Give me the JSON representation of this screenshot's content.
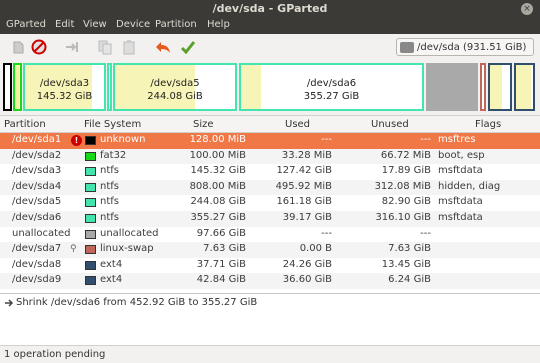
{
  "window": {
    "title": "/dev/sda - GParted",
    "close_glyph": "×"
  },
  "menu": [
    "GParted",
    "Edit",
    "View",
    "Device",
    "Partition",
    "Help"
  ],
  "toolbar": {
    "buttons": [
      {
        "name": "new-partition-icon",
        "enabled": false
      },
      {
        "name": "delete-icon",
        "enabled": true
      },
      {
        "name": "resize-move-icon",
        "enabled": false
      },
      {
        "name": "copy-icon",
        "enabled": false
      },
      {
        "name": "paste-icon",
        "enabled": false
      },
      {
        "name": "undo-icon",
        "enabled": true
      },
      {
        "name": "apply-icon",
        "enabled": true
      }
    ]
  },
  "device_selector": {
    "label": "/dev/sda   (931.51 GiB)"
  },
  "map": {
    "sda3": {
      "name": "/dev/sda3",
      "size": "145.32 GiB"
    },
    "sda5": {
      "name": "/dev/sda5",
      "size": "244.08 GiB"
    },
    "sda6": {
      "name": "/dev/sda6",
      "size": "355.27 GiB"
    }
  },
  "table": {
    "headers": {
      "partition": "Partition",
      "filesystem": "File System",
      "size": "Size",
      "used": "Used",
      "unused": "Unused",
      "flags": "Flags"
    },
    "rows": [
      {
        "partition": "/dev/sda1",
        "fs": "unknown",
        "color": "#000000",
        "size": "128.00 MiB",
        "used": "---",
        "unused": "---",
        "flags": "msftres",
        "icon": "warning"
      },
      {
        "partition": "/dev/sda2",
        "fs": "fat32",
        "color": "#18d918",
        "size": "100.00 MiB",
        "used": "33.28 MiB",
        "unused": "66.72 MiB",
        "flags": "boot, esp",
        "icon": ""
      },
      {
        "partition": "/dev/sda3",
        "fs": "ntfs",
        "color": "#42e5ac",
        "size": "145.32 GiB",
        "used": "127.42 GiB",
        "unused": "17.89 GiB",
        "flags": "msftdata",
        "icon": ""
      },
      {
        "partition": "/dev/sda4",
        "fs": "ntfs",
        "color": "#42e5ac",
        "size": "808.00 MiB",
        "used": "495.92 MiB",
        "unused": "312.08 MiB",
        "flags": "hidden, diag",
        "icon": ""
      },
      {
        "partition": "/dev/sda5",
        "fs": "ntfs",
        "color": "#42e5ac",
        "size": "244.08 GiB",
        "used": "161.18 GiB",
        "unused": "82.90 GiB",
        "flags": "msftdata",
        "icon": ""
      },
      {
        "partition": "/dev/sda6",
        "fs": "ntfs",
        "color": "#42e5ac",
        "size": "355.27 GiB",
        "used": "39.17 GiB",
        "unused": "316.10 GiB",
        "flags": "msftdata",
        "icon": ""
      },
      {
        "partition": "unallocated",
        "fs": "unallocated",
        "color": "#a9a9a9",
        "size": "97.66 GiB",
        "used": "---",
        "unused": "---",
        "flags": "",
        "icon": ""
      },
      {
        "partition": "/dev/sda7",
        "fs": "linux-swap",
        "color": "#c1665a",
        "size": "7.63 GiB",
        "used": "0.00 B",
        "unused": "7.63 GiB",
        "flags": "",
        "icon": "key"
      },
      {
        "partition": "/dev/sda8",
        "fs": "ext4",
        "color": "#314e6c",
        "size": "37.71 GiB",
        "used": "24.26 GiB",
        "unused": "13.45 GiB",
        "flags": "",
        "icon": ""
      },
      {
        "partition": "/dev/sda9",
        "fs": "ext4",
        "color": "#314e6c",
        "size": "42.84 GiB",
        "used": "36.60 GiB",
        "unused": "6.24 GiB",
        "flags": "",
        "icon": ""
      }
    ]
  },
  "pending_ops": [
    "Shrink /dev/sda6 from 452.92 GiB to 355.27 GiB"
  ],
  "status": "1 operation pending"
}
